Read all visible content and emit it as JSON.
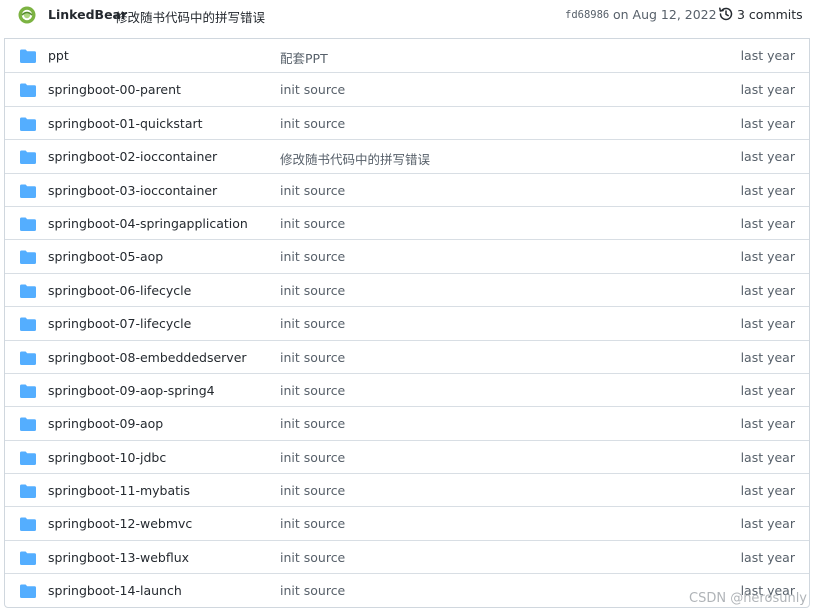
{
  "commit": {
    "author": "LinkedBear",
    "message": "修改随书代码中的拼写错误",
    "sha": "fd68986",
    "date": "on Aug 12, 2022",
    "commits_label": "3 commits"
  },
  "files": [
    {
      "name": "ppt",
      "message": "配套PPT",
      "age": "last year"
    },
    {
      "name": "springboot-00-parent",
      "message": "init source",
      "age": "last year"
    },
    {
      "name": "springboot-01-quickstart",
      "message": "init source",
      "age": "last year"
    },
    {
      "name": "springboot-02-ioccontainer",
      "message": "修改随书代码中的拼写错误",
      "age": "last year"
    },
    {
      "name": "springboot-03-ioccontainer",
      "message": "init source",
      "age": "last year"
    },
    {
      "name": "springboot-04-springapplication",
      "message": "init source",
      "age": "last year"
    },
    {
      "name": "springboot-05-aop",
      "message": "init source",
      "age": "last year"
    },
    {
      "name": "springboot-06-lifecycle",
      "message": "init source",
      "age": "last year"
    },
    {
      "name": "springboot-07-lifecycle",
      "message": "init source",
      "age": "last year"
    },
    {
      "name": "springboot-08-embeddedserver",
      "message": "init source",
      "age": "last year"
    },
    {
      "name": "springboot-09-aop-spring4",
      "message": "init source",
      "age": "last year"
    },
    {
      "name": "springboot-09-aop",
      "message": "init source",
      "age": "last year"
    },
    {
      "name": "springboot-10-jdbc",
      "message": "init source",
      "age": "last year"
    },
    {
      "name": "springboot-11-mybatis",
      "message": "init source",
      "age": "last year"
    },
    {
      "name": "springboot-12-webmvc",
      "message": "init source",
      "age": "last year"
    },
    {
      "name": "springboot-13-webflux",
      "message": "init source",
      "age": "last year"
    },
    {
      "name": "springboot-14-launch",
      "message": "init source",
      "age": "last year"
    }
  ],
  "watermark": "CSDN @herosunly",
  "colors": {
    "folder": "#54aeff",
    "text": "#24292f",
    "muted": "#57606a",
    "border": "#d0d7de",
    "avatar": "#7cb342"
  },
  "icons": {
    "avatar": "avatar-icon",
    "history": "history-icon",
    "folder": "folder-icon"
  }
}
